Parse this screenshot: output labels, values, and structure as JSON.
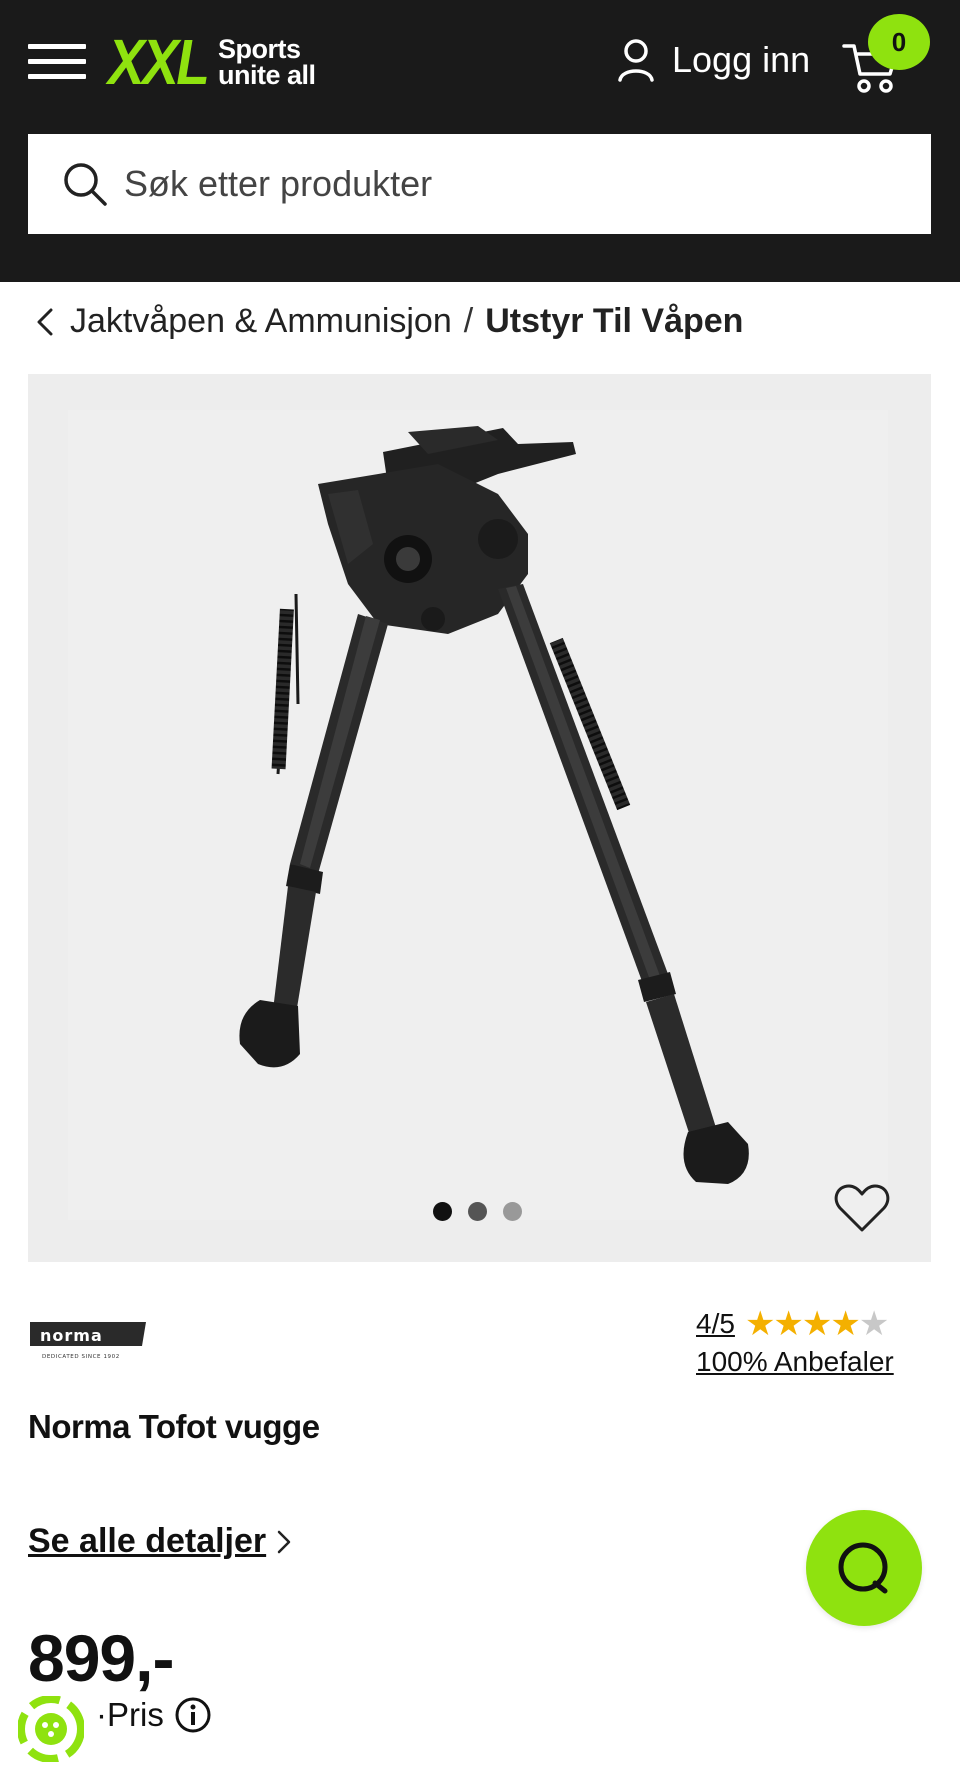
{
  "header": {
    "logo_text": "XXL",
    "tagline_line1": "Sports",
    "tagline_line2": "unite all",
    "login_label": "Logg inn",
    "cart_count": "0",
    "brand_color": "#8fe20f",
    "background_color": "#1a1a1a"
  },
  "search": {
    "placeholder": "Søk etter produkter"
  },
  "breadcrumb": {
    "parent": "Jaktvåpen & Ammunisjon",
    "separator": "/",
    "current": "Utstyr Til Våpen"
  },
  "gallery": {
    "image_count": 3,
    "active_index": 0
  },
  "product": {
    "brand_logo": "norma",
    "brand_tagline": "DEDICATED SINCE 1902",
    "rating": "4/5",
    "rating_value": 4,
    "rating_max": 5,
    "recommend": "100% Anbefaler",
    "title": "Norma Tofot vugge",
    "details_link": "Se alle detaljer",
    "price": "899,-",
    "price_label": "·Pris"
  },
  "icons": {
    "menu": "hamburger-menu-icon",
    "user": "user-icon",
    "cart": "cart-icon",
    "search": "search-icon",
    "back": "chevron-left-icon",
    "heart": "heart-icon",
    "info": "info-icon",
    "chat": "chat-icon"
  }
}
